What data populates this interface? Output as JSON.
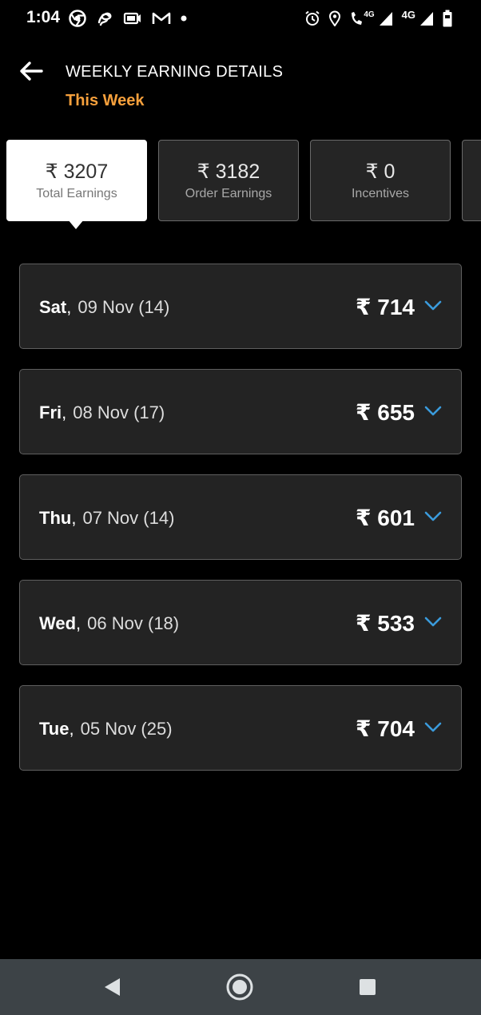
{
  "status_bar": {
    "time": "1:04",
    "left_icons": [
      "chrome-icon",
      "airtel-icon",
      "video-icon",
      "gmail-icon",
      "dot-icon"
    ],
    "network_labels": [
      "4G",
      "4G"
    ],
    "right_icons": [
      "alarm-icon",
      "location-icon",
      "volte-call-icon",
      "signal-icon",
      "signal-icon",
      "battery-icon"
    ]
  },
  "header": {
    "back_icon": "back-arrow-icon",
    "title": "WEEKLY EARNING DETAILS",
    "subtitle": "This Week"
  },
  "summary_cards": [
    {
      "value": "₹ 3207",
      "label": "Total Earnings",
      "active": true
    },
    {
      "value": "₹ 3182",
      "label": "Order Earnings",
      "active": false
    },
    {
      "value": "₹ 0",
      "label": "Incentives",
      "active": false
    }
  ],
  "days": [
    {
      "day": "Sat",
      "date": "09 Nov (14)",
      "amount": "₹ 714"
    },
    {
      "day": "Fri",
      "date": "08 Nov (17)",
      "amount": "₹ 655"
    },
    {
      "day": "Thu",
      "date": "07 Nov (14)",
      "amount": "₹ 601"
    },
    {
      "day": "Wed",
      "date": "06 Nov (18)",
      "amount": "₹ 533"
    },
    {
      "day": "Tue",
      "date": "05 Nov (25)",
      "amount": "₹ 704"
    }
  ],
  "colors": {
    "background": "#000000",
    "accent_orange": "#f6a03c",
    "chevron_blue": "#3a9bdc",
    "card_bg": "#252525",
    "nav_bar": "#3d4347"
  },
  "nav_bar": {
    "icons": [
      "back-triangle-icon",
      "home-circle-icon",
      "recents-square-icon"
    ]
  }
}
